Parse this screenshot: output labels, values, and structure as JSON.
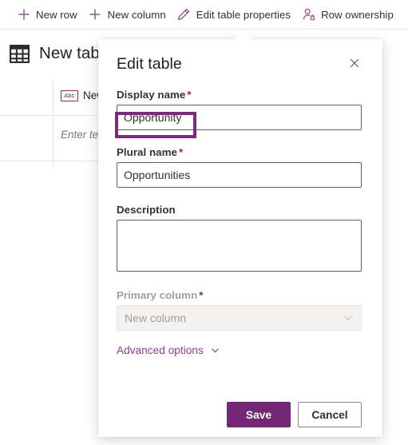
{
  "commandbar": {
    "items": [
      {
        "label": "New row",
        "icon": "plus-icon"
      },
      {
        "label": "New column",
        "icon": "plus-icon"
      },
      {
        "label": "Edit table properties",
        "icon": "pencil-icon"
      },
      {
        "label": "Row ownership",
        "icon": "person-lock-icon"
      }
    ]
  },
  "page": {
    "table_icon": "table-grid-icon",
    "table_title": "New table",
    "grid": {
      "column_header": "New column",
      "column_type_badge": "Abc",
      "cell_placeholder": "Enter text value"
    }
  },
  "dialog": {
    "title": "Edit table",
    "close_icon": "close-icon",
    "fields": {
      "display_name": {
        "label": "Display name",
        "required": "*",
        "value": "Opportunity"
      },
      "plural_name": {
        "label": "Plural name",
        "required": "*",
        "value": "Opportunities"
      },
      "description": {
        "label": "Description",
        "value": ""
      },
      "primary_column": {
        "label": "Primary column",
        "required": "*",
        "value": "New column",
        "disabled": true,
        "chevron_icon": "chevron-down-icon"
      }
    },
    "advanced_options": {
      "label": "Advanced options",
      "chevron_icon": "chevron-down-icon"
    },
    "buttons": {
      "save": "Save",
      "cancel": "Cancel"
    }
  },
  "colors": {
    "accent_purple": "#742774",
    "link_purple": "#8a3e8a",
    "required_red": "#a4262c",
    "annotation_purple": "#7b2d7b"
  }
}
